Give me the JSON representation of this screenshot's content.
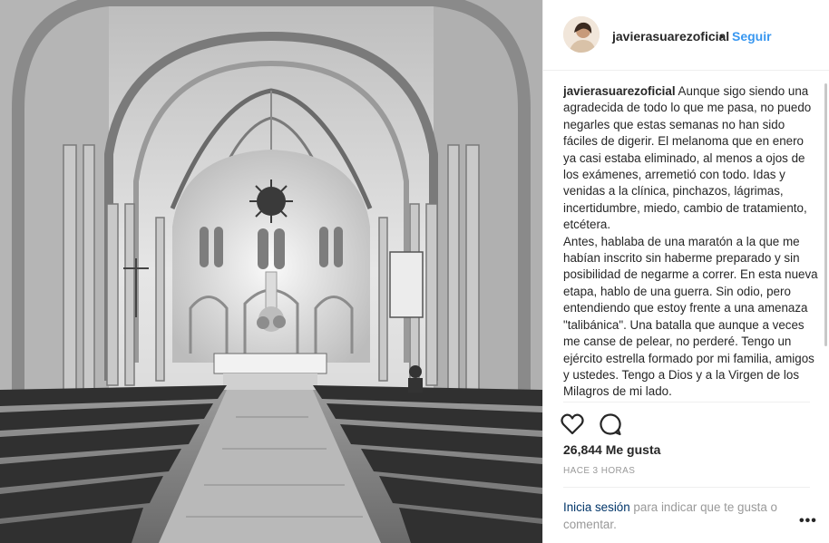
{
  "post": {
    "username": "javierasuarezoficial",
    "separator": "•",
    "follow_label": "Seguir",
    "caption_user": "javierasuarezoficial",
    "caption_text": " Aunque sigo siendo una agradecida de todo lo que me pasa, no puedo negarles que estas semanas no han sido fáciles de digerir. El melanoma que en enero ya casi estaba eliminado, al menos a ojos de los exámenes, arremetió con todo. Idas y venidas a la clínica, pinchazos, lágrimas, incertidumbre, miedo, cambio de tratamiento, etcétera.\nAntes, hablaba de una maratón a la que me habían inscrito sin haberme preparado y sin posibilidad de negarme a correr. En esta nueva etapa, hablo de una guerra. Sin odio, pero entendiendo que estoy frente a una amenaza \"talibánica\". Una batalla que aunque a veces me canse de pelear, no perderé. Tengo un ejército estrella formado por mi familia, amigos y ustedes. Tengo a Dios y a la Virgen de los Milagros de mi lado.",
    "likes": "26,844 Me gusta",
    "time": "HACE 3 HORAS",
    "login_link": "Inicia sesión",
    "login_rest": " para indicar que te gusta o comentar.",
    "more_label": "•••"
  },
  "icons": {
    "like": "heart-outline-icon",
    "comment": "speech-bubble-icon",
    "more": "ellipsis-icon"
  },
  "colors": {
    "link_blue": "#3897f0",
    "login_blue": "#003569",
    "muted": "#999999",
    "text": "#262626"
  }
}
